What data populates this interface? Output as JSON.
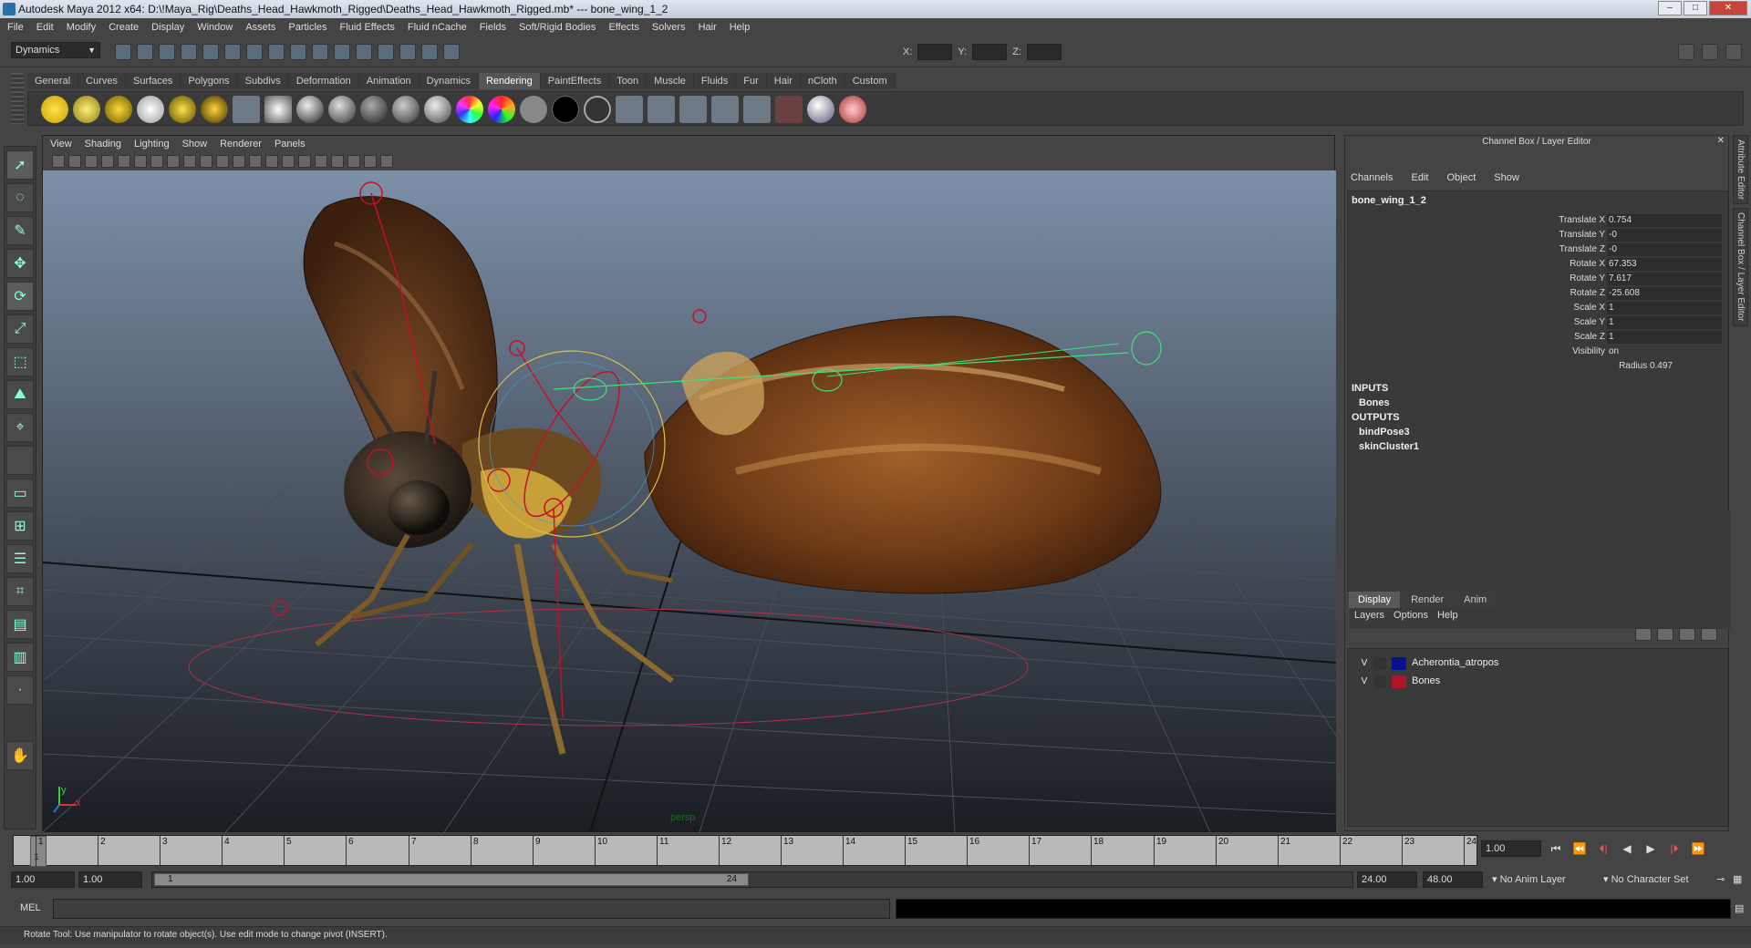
{
  "window": {
    "title": "Autodesk Maya 2012 x64: D:\\!Maya_Rig\\Deaths_Head_Hawkmoth_Rigged\\Deaths_Head_Hawkmoth_Rigged.mb*   ---   bone_wing_1_2",
    "minimize": "–",
    "maximize": "□",
    "close": "✕"
  },
  "menubar": [
    "File",
    "Edit",
    "Modify",
    "Create",
    "Display",
    "Window",
    "Assets",
    "Particles",
    "Fluid Effects",
    "Fluid nCache",
    "Fields",
    "Soft/Rigid Bodies",
    "Effects",
    "Solvers",
    "Hair",
    "Help"
  ],
  "statusline": {
    "mode": "Dynamics",
    "x_label": "X:",
    "y_label": "Y:",
    "z_label": "Z:"
  },
  "shelf": {
    "tabs": [
      "General",
      "Curves",
      "Surfaces",
      "Polygons",
      "Subdivs",
      "Deformation",
      "Animation",
      "Dynamics",
      "Rendering",
      "PaintEffects",
      "Toon",
      "Muscle",
      "Fluids",
      "Fur",
      "Hair",
      "nCloth",
      "Custom"
    ],
    "active_tab": "Rendering"
  },
  "viewport": {
    "menu": [
      "View",
      "Shading",
      "Lighting",
      "Show",
      "Renderer",
      "Panels"
    ],
    "camera_label": "persp",
    "axis_y": "y",
    "axis_x": "x"
  },
  "channel_box": {
    "title": "Channel Box / Layer Editor",
    "menu": [
      "Channels",
      "Edit",
      "Object",
      "Show"
    ],
    "node": "bone_wing_1_2",
    "attributes": [
      {
        "name": "Translate X",
        "value": "0.754"
      },
      {
        "name": "Translate Y",
        "value": "-0"
      },
      {
        "name": "Translate Z",
        "value": "-0"
      },
      {
        "name": "Rotate X",
        "value": "67.353"
      },
      {
        "name": "Rotate Y",
        "value": "7.617"
      },
      {
        "name": "Rotate Z",
        "value": "-25.608"
      },
      {
        "name": "Scale X",
        "value": "1"
      },
      {
        "name": "Scale Y",
        "value": "1"
      },
      {
        "name": "Scale Z",
        "value": "1"
      },
      {
        "name": "Visibility",
        "value": "on"
      }
    ],
    "radius": "Radius 0.497",
    "inputs_label": "INPUTS",
    "inputs": [
      "Bones"
    ],
    "outputs_label": "OUTPUTS",
    "outputs": [
      "bindPose3",
      "skinCluster1"
    ]
  },
  "layer_editor": {
    "tabs": [
      "Display",
      "Render",
      "Anim"
    ],
    "active_tab": "Display",
    "menu": [
      "Layers",
      "Options",
      "Help"
    ],
    "layers": [
      {
        "visible": "V",
        "name": "Acherontia_atropos",
        "color": "#0a0f8c"
      },
      {
        "visible": "V",
        "name": "Bones",
        "color": "#b0122a"
      }
    ]
  },
  "side_tabs": [
    "Attribute Editor",
    "Channel Box / Layer Editor"
  ],
  "timeline": {
    "ticks": [
      "1",
      "2",
      "3",
      "4",
      "5",
      "6",
      "7",
      "8",
      "9",
      "10",
      "11",
      "12",
      "13",
      "14",
      "15",
      "16",
      "17",
      "18",
      "19",
      "20",
      "21",
      "22",
      "23",
      "24"
    ],
    "current_marker": "1",
    "current_frame": "1.00"
  },
  "playback_controls": [
    "⏮",
    "⏪",
    "⏴|",
    "◀",
    "▶",
    "|⏵",
    "⏩"
  ],
  "range": {
    "anim_start": "1.00",
    "playback_start": "1.00",
    "slider_start": "1",
    "slider_end": "24",
    "playback_end": "24.00",
    "anim_end": "48.00",
    "anim_layer": "No Anim Layer",
    "character_set": "No Character Set"
  },
  "command_line": {
    "label": "MEL"
  },
  "help_line": "Rotate Tool: Use manipulator to rotate object(s). Use edit mode to change pivot (INSERT).",
  "colors": {
    "ui_bg": "#444444",
    "viewport_top": "#7c90a8",
    "viewport_bottom": "#1a1d22",
    "joint": "#c4102a",
    "manip_green": "#3fe07a"
  }
}
